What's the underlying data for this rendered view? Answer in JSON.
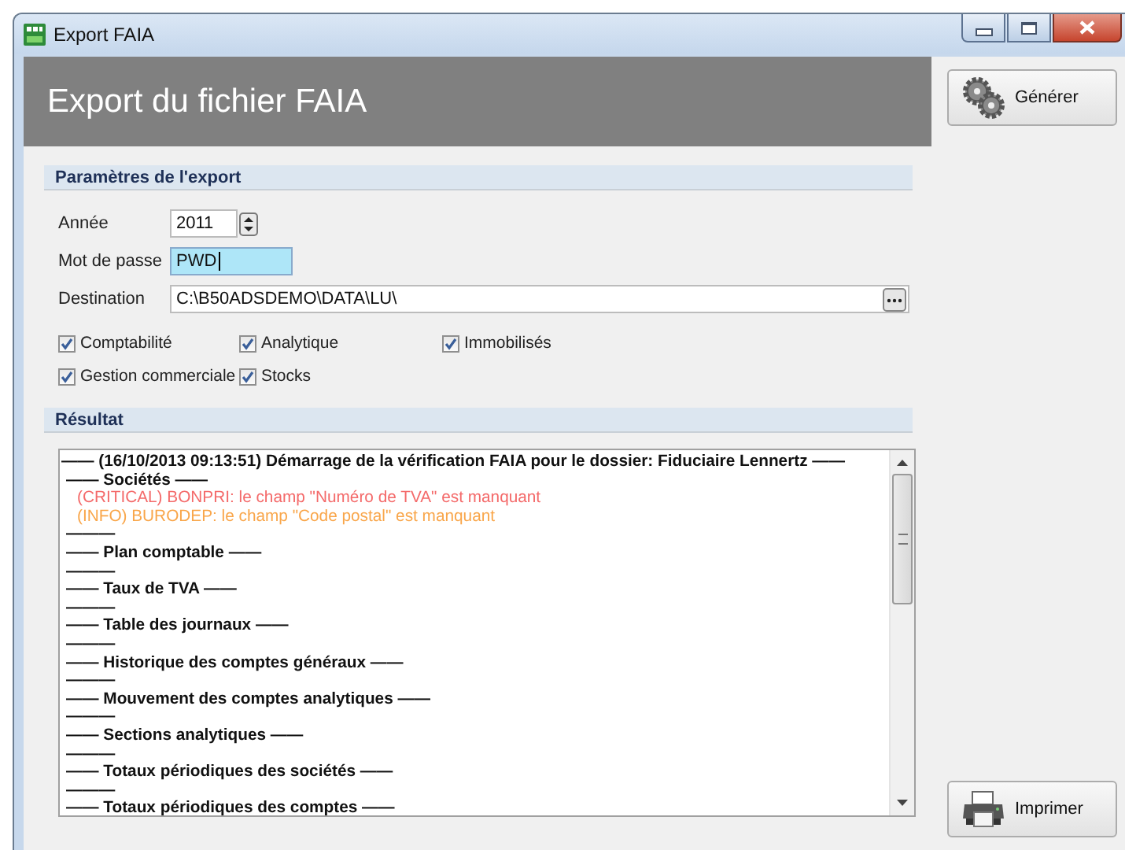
{
  "window": {
    "title": "Export FAIA"
  },
  "header": {
    "title": "Export du fichier FAIA"
  },
  "parameters": {
    "title": "Paramètres de l'export",
    "fields": [
      {
        "kind": "spinner",
        "label": "Année",
        "value": "2011",
        "focused": false
      },
      {
        "kind": "text",
        "label": "Mot de passe",
        "value": "PWD",
        "focused": true
      },
      {
        "kind": "browse",
        "label": "Destination",
        "value": "C:\\B50ADSDEMO\\DATA\\LU\\",
        "focused": false
      }
    ],
    "checkboxes": [
      {
        "label": "Comptabilité",
        "checked": true
      },
      {
        "label": "Analytique",
        "checked": true
      },
      {
        "label": "Immobilisés",
        "checked": true
      },
      {
        "label": "Gestion commerciale",
        "checked": true
      },
      {
        "label": "Stocks",
        "checked": true
      }
    ]
  },
  "result": {
    "title": "Résultat",
    "lines": [
      {
        "kind": "title",
        "text": "—— (16/10/2013 09:13:51) Démarrage de la vérification FAIA pour le dossier: Fiduciaire Lennertz ——"
      },
      {
        "kind": "section",
        "text": "—— Sociétés ——"
      },
      {
        "kind": "critical",
        "text": "(CRITICAL) BONPRI: le champ \"Numéro de TVA\" est manquant"
      },
      {
        "kind": "info",
        "text": "(INFO) BURODEP: le champ \"Code postal\" est manquant"
      },
      {
        "kind": "section",
        "text": "———"
      },
      {
        "kind": "section",
        "text": "—— Plan comptable ——"
      },
      {
        "kind": "section",
        "text": "———"
      },
      {
        "kind": "section",
        "text": "—— Taux de TVA ——"
      },
      {
        "kind": "section",
        "text": "———"
      },
      {
        "kind": "section",
        "text": "—— Table des journaux ——"
      },
      {
        "kind": "section",
        "text": "———"
      },
      {
        "kind": "section",
        "text": "—— Historique des comptes généraux ——"
      },
      {
        "kind": "section",
        "text": "———"
      },
      {
        "kind": "section",
        "text": "—— Mouvement des comptes analytiques ——"
      },
      {
        "kind": "section",
        "text": "———"
      },
      {
        "kind": "section",
        "text": "—— Sections analytiques ——"
      },
      {
        "kind": "section",
        "text": "———"
      },
      {
        "kind": "section",
        "text": "—— Totaux périodiques des sociétés ——"
      },
      {
        "kind": "section",
        "text": "———"
      },
      {
        "kind": "section",
        "text": "—— Totaux périodiques des comptes ——"
      }
    ]
  },
  "buttons": [
    {
      "kind": "gears",
      "label": "Générer"
    },
    {
      "kind": "printer",
      "label": "Imprimer"
    }
  ]
}
